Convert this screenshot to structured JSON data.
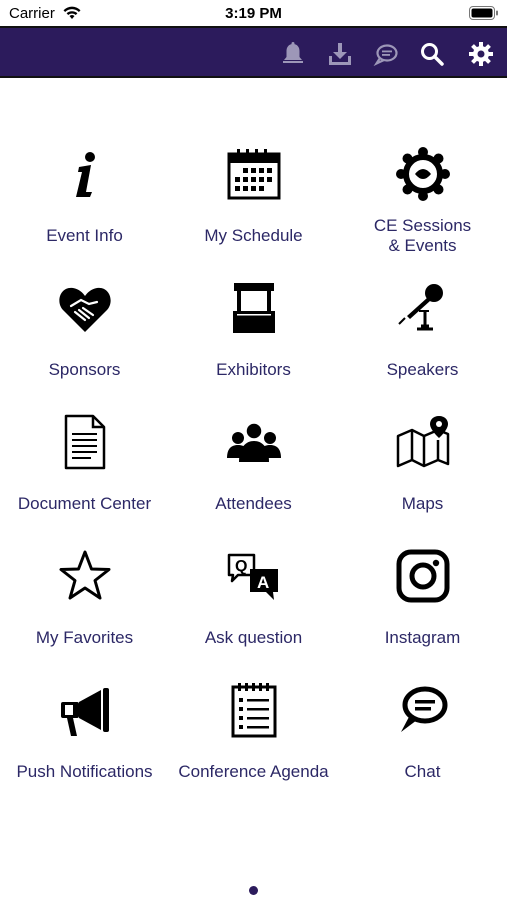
{
  "status_bar": {
    "carrier": "Carrier",
    "time": "3:19 PM"
  },
  "toolbar": {
    "background": "#2c1b5c",
    "icons": [
      "bell-icon",
      "download-icon",
      "chat-bubble-icon",
      "search-icon",
      "gear-icon"
    ]
  },
  "tiles": [
    {
      "label": "Event Info",
      "icon": "info-icon"
    },
    {
      "label": "My Schedule",
      "icon": "calendar-icon"
    },
    {
      "label": "CE Sessions\n& Events",
      "icon": "gear-people-icon"
    },
    {
      "label": "Sponsors",
      "icon": "heart-handshake-icon"
    },
    {
      "label": "Exhibitors",
      "icon": "booth-icon"
    },
    {
      "label": "Speakers",
      "icon": "microphone-icon"
    },
    {
      "label": "Document Center",
      "icon": "document-icon"
    },
    {
      "label": "Attendees",
      "icon": "people-icon"
    },
    {
      "label": "Maps",
      "icon": "map-icon"
    },
    {
      "label": "My Favorites",
      "icon": "star-icon"
    },
    {
      "label": "Ask question",
      "icon": "qa-icon"
    },
    {
      "label": "Instagram",
      "icon": "instagram-icon"
    },
    {
      "label": "Push Notifications",
      "icon": "megaphone-icon"
    },
    {
      "label": "Conference Agenda",
      "icon": "agenda-icon"
    },
    {
      "label": "Chat",
      "icon": "chat-icon"
    }
  ],
  "pager": {
    "current_page": 1,
    "total_pages": 1
  }
}
